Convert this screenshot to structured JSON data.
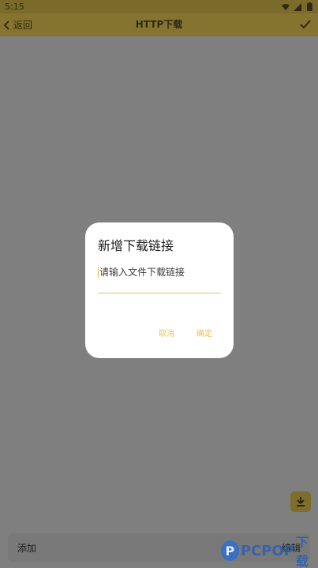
{
  "status_bar": {
    "time": "5:15",
    "icons": [
      "wifi-icon",
      "signal-icon",
      "battery-icon"
    ]
  },
  "app_bar": {
    "back_label": "返回",
    "title": "HTTP下载",
    "confirm_icon": "check-icon"
  },
  "dialog": {
    "title": "新增下载链接",
    "input_placeholder": "请输入文件下载链接",
    "input_value": "",
    "cancel_label": "取消",
    "ok_label": "确定"
  },
  "fab": {
    "icon": "download-icon"
  },
  "bottom_bar": {
    "add_label": "添加",
    "edit_label": "编辑"
  },
  "watermark": {
    "brand": "PCPOP",
    "suffix": "下载"
  },
  "colors": {
    "accent": "#e9c15b",
    "app_bar_dimmed": "#84742f",
    "overlay": "#7f7f7f"
  }
}
